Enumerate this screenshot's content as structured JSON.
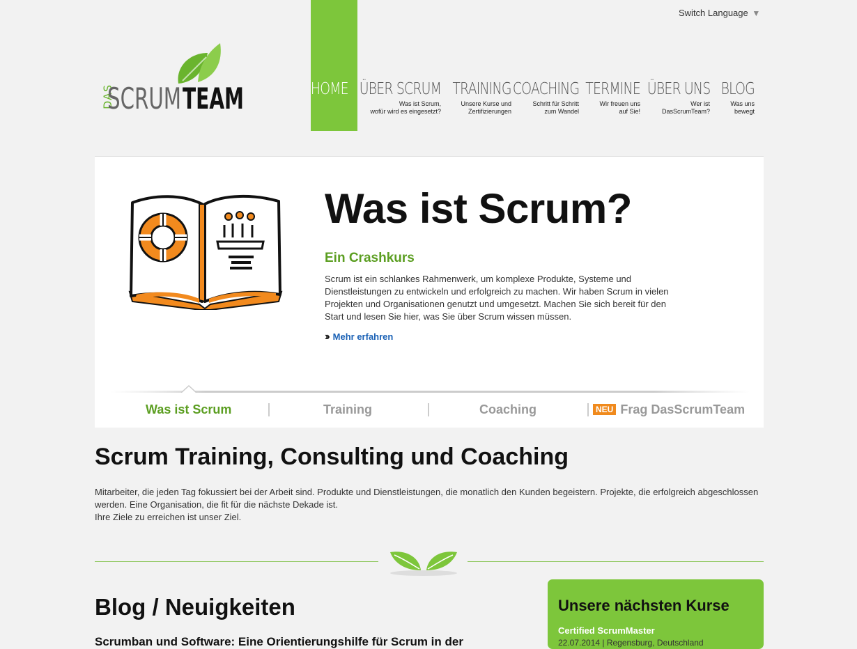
{
  "header": {
    "switch_language": "Switch Language",
    "logo_text": {
      "das": "DAS",
      "scrum": "SCRUM",
      "team": "TEAM"
    }
  },
  "nav": [
    {
      "id": "home",
      "title": "HOME",
      "sub": [],
      "active": true
    },
    {
      "id": "ueber-scrum",
      "title": "ÜBER SCRUM",
      "sub": [
        "Was ist Scrum,",
        "wofür wird es eingesetzt?"
      ]
    },
    {
      "id": "training",
      "title": "TRAINING",
      "sub": [
        "Unsere Kurse und",
        "Zertifizierungen"
      ]
    },
    {
      "id": "coaching",
      "title": "COACHING",
      "sub": [
        "Schritt für Schritt",
        "zum Wandel"
      ]
    },
    {
      "id": "termine",
      "title": "TERMINE",
      "sub": [
        "Wir freuen uns",
        "auf Sie!"
      ]
    },
    {
      "id": "ueber-uns",
      "title": "ÜBER UNS",
      "sub": [
        "Wer ist",
        "DasScrumTeam?"
      ]
    },
    {
      "id": "blog",
      "title": "BLOG",
      "sub": [
        "Was uns",
        "bewegt"
      ]
    }
  ],
  "hero": {
    "title": "Was ist Scrum?",
    "subtitle": "Ein Crashkurs",
    "text": "Scrum ist ein schlankes Rahmenwerk, um komplexe Produkte, Systeme und Dienstleistungen zu entwickeln und erfolgreich zu machen. Wir haben Scrum in vielen Projekten und Organisationen genutzt und umgesetzt. Machen Sie sich bereit für den Start und lesen Sie hier, was Sie über Scrum wissen müssen.",
    "more_link": "Mehr erfahren"
  },
  "tabs": {
    "items": [
      "Was ist Scrum",
      "Training",
      "Coaching",
      "Frag DasScrumTeam"
    ],
    "neu_badge": "NEU",
    "active_index": 0
  },
  "intro": {
    "title": "Scrum Training, Consulting und Coaching",
    "line1": "Mitarbeiter, die jeden Tag fokussiert bei der Arbeit sind. Produkte und Dienstleistungen, die monatlich den Kunden begeistern. Projekte, die erfolgreich abgeschlossen werden. Eine Organisation, die fit für die nächste Dekade ist.",
    "line2": "Ihre Ziele zu erreichen ist unser Ziel."
  },
  "blog": {
    "title": "Blog / Neuigkeiten",
    "first_post_title": "Scrumban und Software: Eine Orientierungshilfe für Scrum in der"
  },
  "courses": {
    "title": "Unsere nächsten Kurse",
    "items": [
      {
        "name": "Certified ScrumMaster",
        "meta": "22.07.2014 | Regensburg, Deutschland"
      }
    ]
  },
  "colors": {
    "brand_green": "#7dc63b",
    "text_green": "#5b9e21",
    "link_blue": "#1a61b5",
    "accent_orange": "#f08a1d"
  },
  "icons": [
    "chevron-down-icon",
    "book-illustration",
    "double-chevron-right-icon",
    "leaves-icon"
  ]
}
